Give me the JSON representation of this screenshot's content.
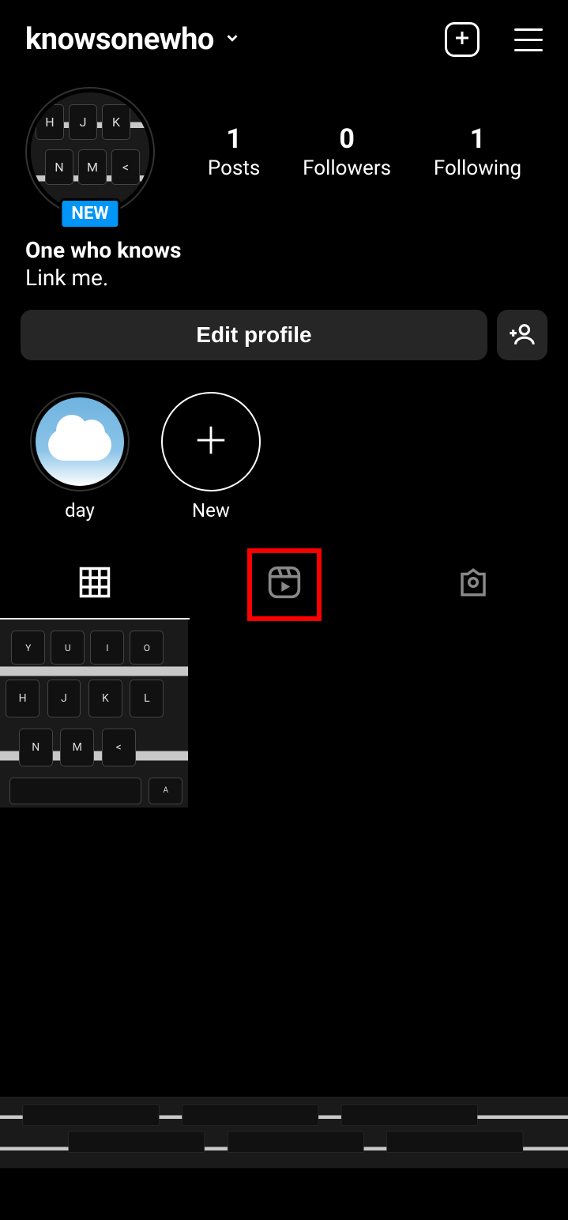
{
  "header": {
    "username": "knowsonewho"
  },
  "profile": {
    "badge": "NEW",
    "display_name": "One who knows",
    "bio": "Link me."
  },
  "stats": {
    "posts_count": "1",
    "posts_label": "Posts",
    "followers_count": "0",
    "followers_label": "Followers",
    "following_count": "1",
    "following_label": "Following"
  },
  "actions": {
    "edit_profile": "Edit profile"
  },
  "highlights": [
    {
      "label": "day"
    },
    {
      "label": "New"
    }
  ]
}
